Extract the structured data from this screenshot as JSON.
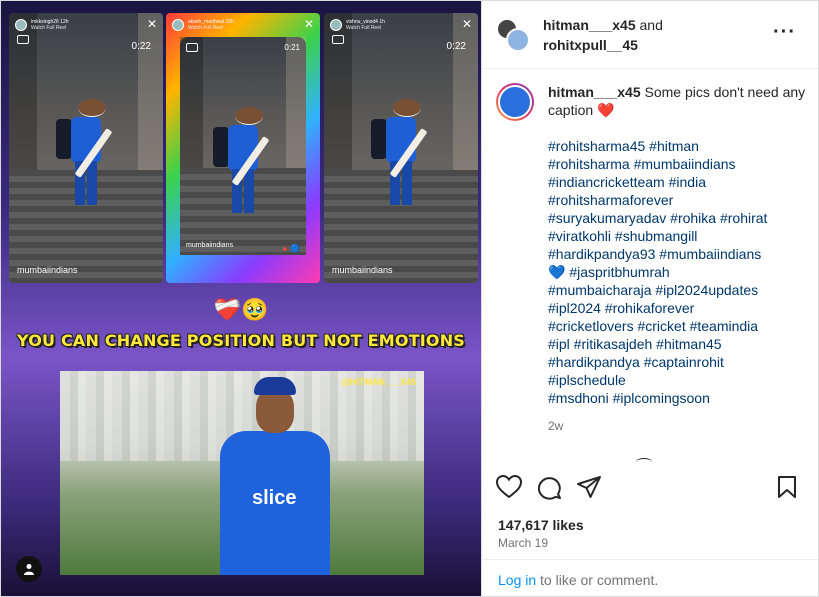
{
  "media": {
    "stories": [
      {
        "user": "imkksingh26",
        "ago": "12h",
        "sub": "Watch Full Reel",
        "duration": "0:22",
        "tag": "mumbaiindians"
      },
      {
        "user": "akash_madhwal",
        "ago": "15h",
        "sub": "Watch Full Reel",
        "duration": "0:21",
        "tag": "mumbaiindians"
      },
      {
        "user": "vishnu_vinod4",
        "ago": "1h",
        "sub": "Watch Full Reel",
        "duration": "0:22",
        "tag": "mumbaiindians"
      }
    ],
    "emojis": "❤️‍🩹🥹",
    "tagline": "YOU CAN CHANGE POSITION BUT NOT EMOTIONS",
    "watermark": "@HITMAN___X45",
    "jersey_text": "slice"
  },
  "header": {
    "user1": "hitman___x45",
    "and": " and",
    "user2": "rohitxpull__45"
  },
  "caption": {
    "username": "hitman___x45",
    "text": " Some pics don't need any caption ❤️",
    "hashtags": "#rohitsharma45 #hitman\n#rohitsharma #mumbaiindians\n#indiancricketteam #india\n#rohitsharmaforever\n#suryakumaryadav #rohika #rohirat\n#viratkohli #shubmangill\n#hardikpandya93 #mumbaiindians\n💙 #jaspritbhumrah\n#mumbaicharaja #ipl2024updates\n#ipl2024 #rohikaforever\n#cricketlovers #cricket #teamindia\n#ipl #ritikasajdeh #hitman45\n#hardikpandya #captainrohit\n#iplschedule\n#msdhoni #iplcomingsoon",
    "ago": "2w"
  },
  "engagement": {
    "likes": "147,617 likes",
    "date": "March 19"
  },
  "footer": {
    "login": "Log in",
    "rest": " to like or comment."
  },
  "icons": [
    "heart-icon",
    "comment-icon",
    "share-icon",
    "bookmark-icon",
    "more-icon",
    "avatar-icon"
  ]
}
